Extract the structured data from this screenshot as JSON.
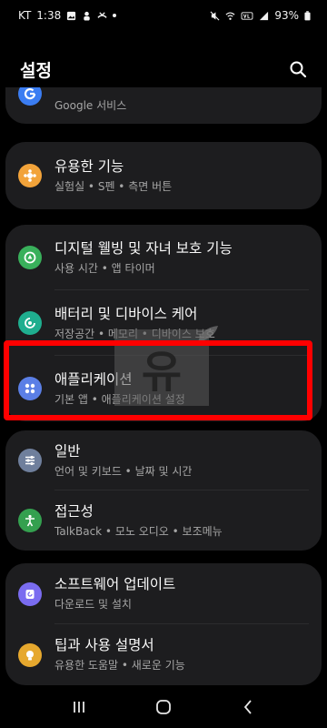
{
  "status": {
    "carrier": "KT",
    "time": "1:38",
    "battery": "93%"
  },
  "header": {
    "title": "설정"
  },
  "items": [
    {
      "title": "",
      "subtitle": "Google 서비스",
      "icon": "google-icon",
      "color": "#3b7df2"
    },
    {
      "title": "유용한 기능",
      "subtitle": "실험실 • S펜 • 측면 버튼",
      "icon": "star-gear-icon",
      "color": "#f2a33a"
    },
    {
      "title": "디지털 웰빙 및 자녀 보호 기능",
      "subtitle": "사용 시간 • 앱 타이머",
      "icon": "wellbeing-icon",
      "color": "#39b05b"
    },
    {
      "title": "배터리 및 디바이스 케어",
      "subtitle": "저장공간 • 메모리 • 디바이스 보호",
      "icon": "device-care-icon",
      "color": "#1fae8f"
    },
    {
      "title": "애플리케이션",
      "subtitle": "기본 앱 • 애플리케이션 설정",
      "icon": "apps-icon",
      "color": "#5b7fe6"
    },
    {
      "title": "일반",
      "subtitle": "언어 및 키보드 • 날짜 및 시간",
      "icon": "sliders-icon",
      "color": "#6f7f9c"
    },
    {
      "title": "접근성",
      "subtitle": "TalkBack • 모노 오디오 • 보조메뉴",
      "icon": "accessibility-icon",
      "color": "#34a04f"
    },
    {
      "title": "소프트웨어 업데이트",
      "subtitle": "다운로드 및 설치",
      "icon": "update-icon",
      "color": "#7a6cf0"
    },
    {
      "title": "팁과 사용 설명서",
      "subtitle": "유용한 도움말 • 새로운 기능",
      "icon": "lightbulb-icon",
      "color": "#e6a82e"
    }
  ],
  "watermark": {
    "text": "유"
  },
  "colors": {
    "background": "#000000",
    "card": "#1d1d1f",
    "highlight": "#ff0000"
  }
}
